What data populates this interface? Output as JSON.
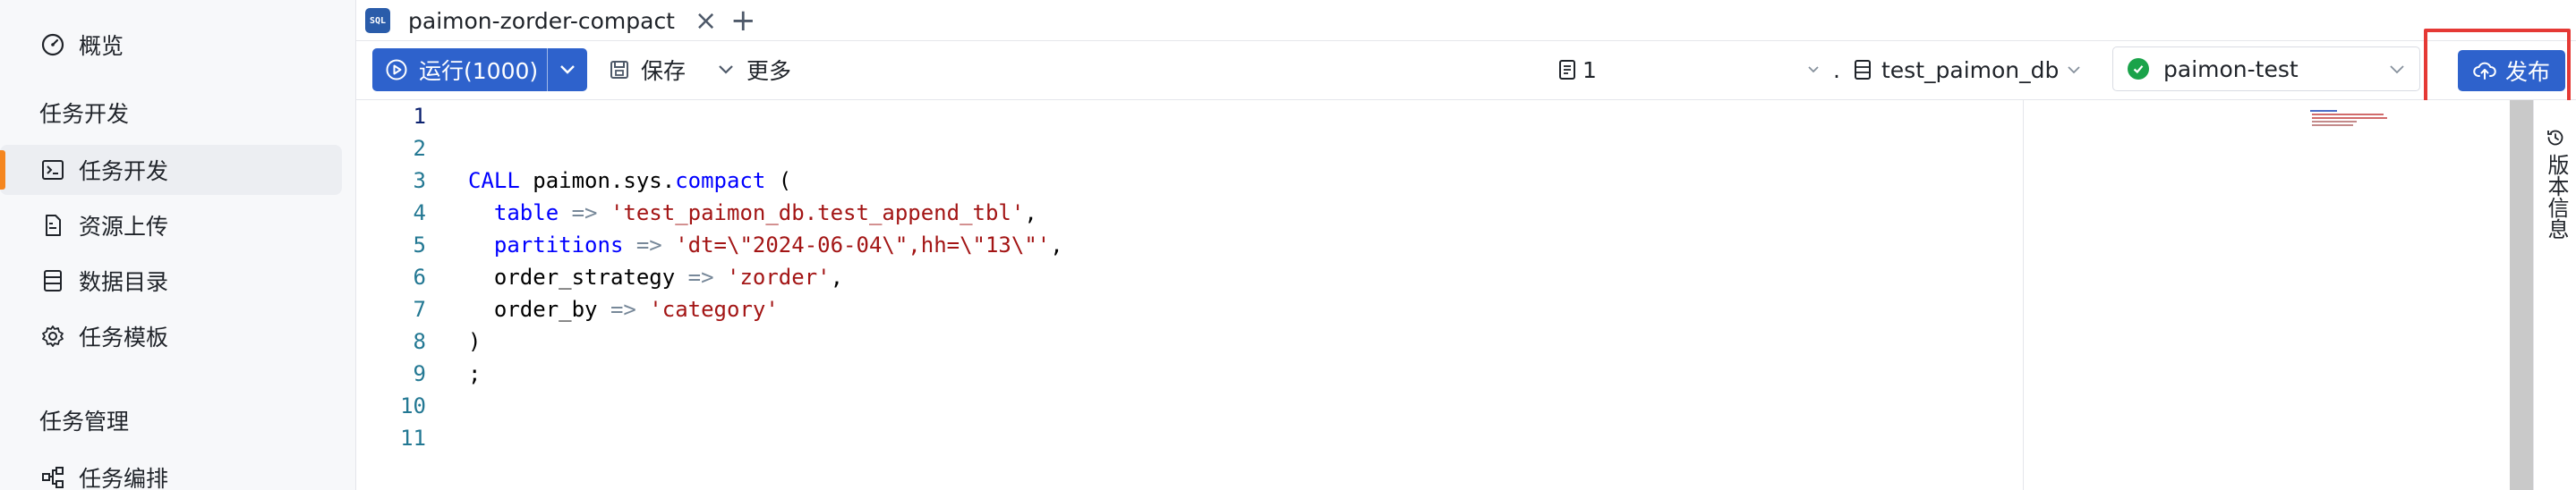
{
  "sidebar": {
    "items_top": [
      {
        "label": "概览",
        "icon": "dashboard-gauge-icon"
      }
    ],
    "group_dev": "任务开发",
    "items_dev": [
      {
        "label": "任务开发",
        "icon": "terminal-icon",
        "active": true
      },
      {
        "label": "资源上传",
        "icon": "file-icon"
      },
      {
        "label": "数据目录",
        "icon": "database-list-icon"
      },
      {
        "label": "任务模板",
        "icon": "gear-icon"
      }
    ],
    "group_manage": "任务管理",
    "items_manage": [
      {
        "label": "任务编排",
        "icon": "workflow-icon"
      }
    ]
  },
  "tabs": [
    {
      "label": "paimon-zorder-compact",
      "icon": "sql-file-icon"
    }
  ],
  "toolbar": {
    "run_label": "运行(1000)",
    "save_label": "保存",
    "more_label": "更多",
    "catalog_value": "1",
    "catalog_separator": ".",
    "database_value": "test_paimon_db",
    "env_value": "paimon-test",
    "publish_label": "发布"
  },
  "editor": {
    "line_numbers": [
      "1",
      "2",
      "3",
      "4",
      "5",
      "6",
      "7",
      "8",
      "9",
      "10",
      "11"
    ],
    "current_line": 1
  },
  "right_panel": {
    "version_label": "版本信息"
  },
  "colors": {
    "primary": "#2e62cc",
    "active_indicator": "#f5861f",
    "highlight_box": "#e53935",
    "env_ok": "#1aa34a"
  }
}
